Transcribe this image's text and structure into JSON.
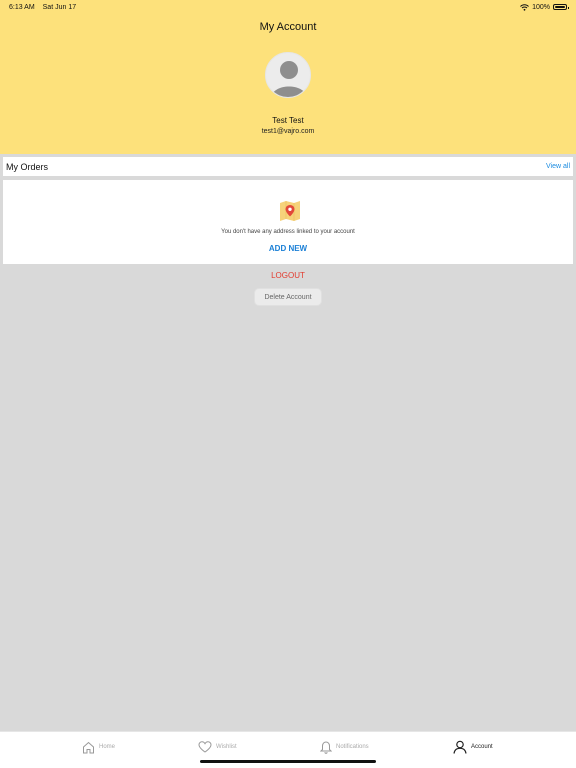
{
  "status_bar": {
    "time": "6:13 AM",
    "date": "Sat Jun 17",
    "battery": "100%"
  },
  "header": {
    "title": "My Account"
  },
  "user": {
    "name": "Test Test",
    "email": "test1@vajro.com"
  },
  "orders": {
    "title": "My Orders",
    "view_all": "View all"
  },
  "address": {
    "empty_message": "You don't have any address linked to your account",
    "add_new": "ADD NEW"
  },
  "actions": {
    "logout": "LOGOUT",
    "delete_account": "Delete Account"
  },
  "tabs": [
    {
      "label": "Home",
      "icon": "home-icon",
      "active": false
    },
    {
      "label": "Wishlist",
      "icon": "heart-icon",
      "active": false
    },
    {
      "label": "Notifications",
      "icon": "bell-icon",
      "active": false
    },
    {
      "label": "Account",
      "icon": "user-icon",
      "active": true
    }
  ],
  "colors": {
    "header_bg": "#fde17b",
    "link_blue": "#1a8be0",
    "logout_red": "#e23b2e",
    "page_bg": "#d9d9d9"
  }
}
